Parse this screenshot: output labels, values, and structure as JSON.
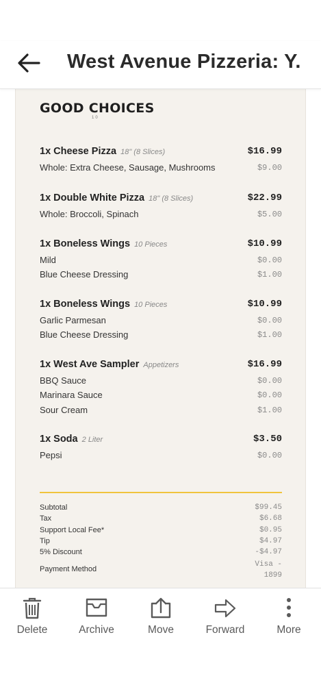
{
  "header": {
    "title": "West Avenue Pizzeria: Y..."
  },
  "receipt": {
    "brand": "GOOD CHOICES",
    "brand_sub": "10",
    "items": [
      {
        "title": "1x Cheese Pizza",
        "size": "18\" (8 Slices)",
        "price": "$16.99",
        "mods": [
          {
            "name": "Whole: Extra Cheese, Sausage, Mushrooms",
            "price": "$9.00"
          }
        ]
      },
      {
        "title": "1x Double White Pizza",
        "size": "18\" (8 Slices)",
        "price": "$22.99",
        "mods": [
          {
            "name": "Whole: Broccoli, Spinach",
            "price": "$5.00"
          }
        ]
      },
      {
        "title": "1x Boneless Wings",
        "size": "10 Pieces",
        "price": "$10.99",
        "mods": [
          {
            "name": "Mild",
            "price": "$0.00"
          },
          {
            "name": "Blue Cheese Dressing",
            "price": "$1.00"
          }
        ]
      },
      {
        "title": "1x Boneless Wings",
        "size": "10 Pieces",
        "price": "$10.99",
        "mods": [
          {
            "name": "Garlic Parmesan",
            "price": "$0.00"
          },
          {
            "name": "Blue Cheese Dressing",
            "price": "$1.00"
          }
        ]
      },
      {
        "title": "1x West Ave Sampler",
        "size": "Appetizers",
        "price": "$16.99",
        "mods": [
          {
            "name": "BBQ Sauce",
            "price": "$0.00"
          },
          {
            "name": "Marinara Sauce",
            "price": "$0.00"
          },
          {
            "name": "Sour Cream",
            "price": "$1.00"
          }
        ]
      },
      {
        "title": "1x Soda",
        "size": "2 Liter",
        "price": "$3.50",
        "mods": [
          {
            "name": "Pepsi",
            "price": "$0.00"
          }
        ]
      }
    ],
    "totals": [
      {
        "label": "Subtotal",
        "value": "$99.45"
      },
      {
        "label": "Tax",
        "value": "$6.68"
      },
      {
        "label": "Support Local Fee*",
        "value": "$0.95"
      },
      {
        "label": "Tip",
        "value": "$4.97"
      },
      {
        "label": "5% Discount",
        "value": "-$4.97"
      }
    ],
    "payment": {
      "label": "Payment Method",
      "value": "Visa - 1899"
    }
  },
  "toolbar": {
    "delete": "Delete",
    "archive": "Archive",
    "move": "Move",
    "forward": "Forward",
    "more": "More"
  },
  "colors": {
    "accent_divider": "#f0c43c",
    "receipt_bg": "#f5f2ed",
    "toolbar_label": "#5a5a5a"
  }
}
